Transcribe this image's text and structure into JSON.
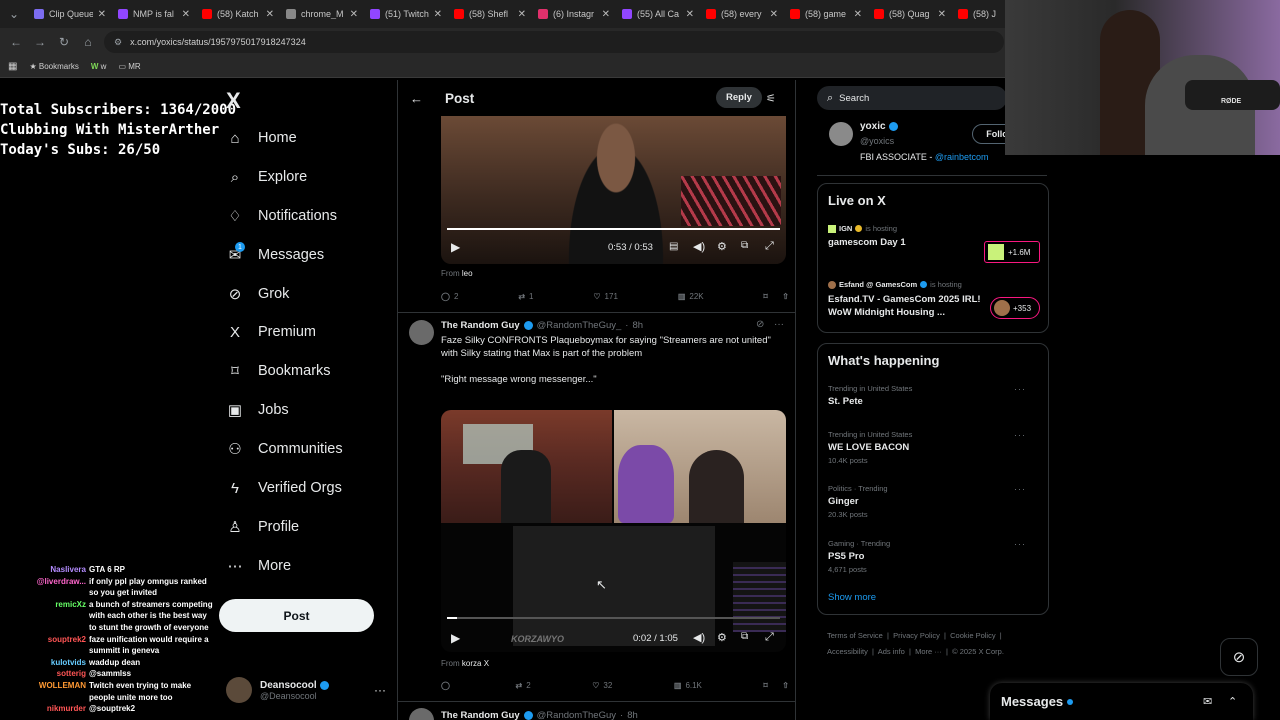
{
  "browser": {
    "tabs": [
      {
        "label": "Clip Queue",
        "color": "#7c6cf0"
      },
      {
        "label": "NMP is fal",
        "color": "#9146ff"
      },
      {
        "label": "(58) Katch",
        "color": "#ff0000"
      },
      {
        "label": "chrome_M",
        "color": "#888888"
      },
      {
        "label": "(51) Twitch",
        "color": "#9146ff"
      },
      {
        "label": "(58) Shefl",
        "color": "#ff0000"
      },
      {
        "label": "(6) Instagr",
        "color": "#e1306c"
      },
      {
        "label": "(55) All Ca",
        "color": "#9146ff"
      },
      {
        "label": "(58) every",
        "color": "#ff0000"
      },
      {
        "label": "(58) game",
        "color": "#ff0000"
      },
      {
        "label": "(58) Quag",
        "color": "#ff0000"
      },
      {
        "label": "(58) J",
        "color": "#ff0000"
      }
    ],
    "url": "x.com/yoxics/status/1957975017918247324",
    "bookmarks": [
      "Bookmarks",
      "w",
      "MR"
    ]
  },
  "overlay": {
    "stats": [
      "Total Subscribers: 1364/2000",
      "Clubbing With MisterArther",
      "Today's Subs: 26/50"
    ],
    "chat": [
      {
        "user": "Naslivera",
        "msg": "GTA 6 RP",
        "color": "#b48cff"
      },
      {
        "user": "@liverdraw...",
        "msg": "if only ppl play omngus ranked so you get invited",
        "color": "#ff66cc"
      },
      {
        "user": "remicXz",
        "msg": "a bunch of streamers competing with each other is the best way to stunt the growth of everyone",
        "color": "#66ff66"
      },
      {
        "user": "souptrek2",
        "msg": "faze unification would require a summitt in geneva",
        "color": "#ff5555"
      },
      {
        "user": "kulotvids",
        "msg": "waddup dean",
        "color": "#66ccff"
      },
      {
        "user": "sotterig",
        "msg": "@sammlss",
        "color": "#ff5555"
      },
      {
        "user": "WOLLEMAN",
        "msg": "Twitch even trying to make people unite more too",
        "color": "#ff9933"
      },
      {
        "user": "nikmurder",
        "msg": "@souptrek2",
        "color": "#ff5555"
      }
    ]
  },
  "x": {
    "logo": "X",
    "nav": [
      {
        "label": "Home",
        "icon": "home-icon",
        "glyph": "⌂"
      },
      {
        "label": "Explore",
        "icon": "search-icon",
        "glyph": "⌕"
      },
      {
        "label": "Notifications",
        "icon": "bell-icon",
        "glyph": "♢"
      },
      {
        "label": "Messages",
        "icon": "envelope-icon",
        "glyph": "✉"
      },
      {
        "label": "Grok",
        "icon": "grok-icon",
        "glyph": "⊘"
      },
      {
        "label": "Premium",
        "icon": "x-premium-icon",
        "glyph": "X"
      },
      {
        "label": "Bookmarks",
        "icon": "bookmark-icon",
        "glyph": "⌑"
      },
      {
        "label": "Jobs",
        "icon": "briefcase-icon",
        "glyph": "▣"
      },
      {
        "label": "Communities",
        "icon": "people-icon",
        "glyph": "⚇"
      },
      {
        "label": "Verified Orgs",
        "icon": "lightning-icon",
        "glyph": "ϟ"
      },
      {
        "label": "Profile",
        "icon": "person-icon",
        "glyph": "♙"
      },
      {
        "label": "More",
        "icon": "more-circle-icon",
        "glyph": "⋯"
      }
    ],
    "messages_badge": "1",
    "post_button": "Post",
    "account": {
      "name": "Deansocool",
      "handle": "@Deansocool"
    },
    "main": {
      "title": "Post",
      "reply_button": "Reply",
      "video1": {
        "time": "0:53 / 0:53"
      },
      "from1_prefix": "From",
      "from1_name": "leo",
      "actions1": {
        "replies": "2",
        "reposts": "1",
        "likes": "171",
        "views": "22K"
      },
      "tweet2": {
        "name": "The Random Guy",
        "handle": "@RandomTheGuy_",
        "time": "8h",
        "text": "Faze Silky CONFRONTS Plaqueboymax for saying \"Streamers are not united\" with Silky stating that Max is part of the problem",
        "quote": "\"Right message wrong messenger...\"",
        "video_time": "0:02 / 1:05",
        "watermark": "KORZAWYO",
        "from_prefix": "From",
        "from_name": "korza X",
        "actions": {
          "replies": "",
          "reposts": "2",
          "likes": "32",
          "views": "6.1K"
        }
      },
      "tweet3": {
        "name": "The Random Guy",
        "handle": "@RandomTheGuy",
        "time": "8h"
      }
    },
    "right": {
      "search_placeholder": "Search",
      "profile": {
        "name": "yoxic",
        "handle": "@yoxics",
        "bio_prefix": "FBI ASSOCIATE - ",
        "bio_link": "@rainbetcom",
        "follow": "Follo"
      },
      "live_title": "Live on X",
      "live": [
        {
          "host": "IGN",
          "status": "is hosting",
          "title": "gamescom Day 1",
          "count": "+1.6M"
        },
        {
          "host": "Esfand @ GamesCom",
          "status": "is hosting",
          "title": "Esfand.TV - GamesCom 2025 IRL! WoW Midnight Housing ...",
          "count": "+353"
        }
      ],
      "happening_title": "What's happening",
      "trends": [
        {
          "meta": "Trending in United States",
          "title": "St. Pete",
          "sub": ""
        },
        {
          "meta": "Trending in United States",
          "title": "WE LOVE BACON",
          "sub": "10.4K posts"
        },
        {
          "meta": "Politics · Trending",
          "title": "Ginger",
          "sub": "20.3K posts"
        },
        {
          "meta": "Gaming · Trending",
          "title": "PS5 Pro",
          "sub": "4,671 posts"
        }
      ],
      "show_more": "Show more",
      "footer": [
        "Terms of Service",
        "Privacy Policy",
        "Cookie Policy",
        "Accessibility",
        "Ads info",
        "More ···",
        "© 2025 X Corp."
      ]
    },
    "messages_bar": "Messages",
    "webcam_label": "RØDE"
  },
  "colors": {
    "accent": "#1d9bf0",
    "background": "#000000",
    "border": "#2f3336",
    "muted": "#71767b"
  }
}
